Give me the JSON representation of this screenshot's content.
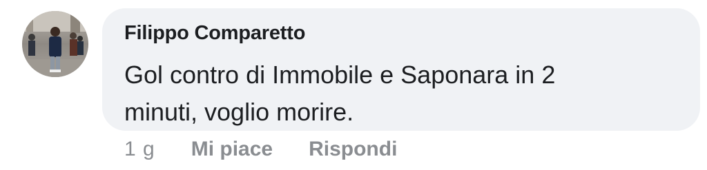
{
  "comment": {
    "author": "Filippo Comparetto",
    "text": "Gol contro di Immobile e Saponara in 2 minuti, voglio morire.",
    "timestamp": "1 g",
    "actions": {
      "like": "Mi piace",
      "reply": "Rispondi"
    },
    "avatar_icon": "profile-photo"
  },
  "colors": {
    "bubble_background": "#f0f2f5",
    "text": "#1c1e21",
    "secondary_text": "#8a8d91"
  }
}
